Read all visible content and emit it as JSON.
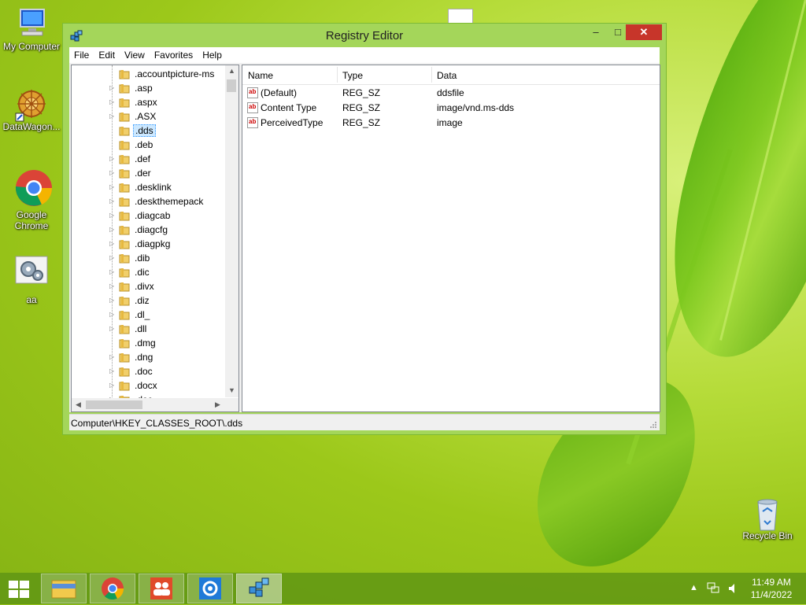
{
  "desktop": {
    "icons": [
      {
        "label": "My Computer",
        "icon": "computer-icon"
      },
      {
        "label": "DataWagon...",
        "icon": "datawagon-icon"
      },
      {
        "label": "Google Chrome",
        "icon": "chrome-icon"
      },
      {
        "label": "aa",
        "icon": "settings-file-icon"
      },
      {
        "label": "Recycle Bin",
        "icon": "recycle-bin-icon"
      }
    ]
  },
  "window": {
    "title": "Registry Editor",
    "menu": [
      "File",
      "Edit",
      "View",
      "Favorites",
      "Help"
    ],
    "controls": {
      "minimize": "–",
      "maximize": "□",
      "close": "✕"
    },
    "tree": {
      "items": [
        {
          "name": ".accountpicture-ms",
          "expandable": false
        },
        {
          "name": ".asp",
          "expandable": true
        },
        {
          "name": ".aspx",
          "expandable": true
        },
        {
          "name": ".ASX",
          "expandable": true
        },
        {
          "name": ".dds",
          "expandable": false,
          "selected": true
        },
        {
          "name": ".deb",
          "expandable": false
        },
        {
          "name": ".def",
          "expandable": true
        },
        {
          "name": ".der",
          "expandable": true
        },
        {
          "name": ".desklink",
          "expandable": true
        },
        {
          "name": ".deskthemepack",
          "expandable": true
        },
        {
          "name": ".diagcab",
          "expandable": true
        },
        {
          "name": ".diagcfg",
          "expandable": true
        },
        {
          "name": ".diagpkg",
          "expandable": true
        },
        {
          "name": ".dib",
          "expandable": true
        },
        {
          "name": ".dic",
          "expandable": true
        },
        {
          "name": ".divx",
          "expandable": true
        },
        {
          "name": ".diz",
          "expandable": true
        },
        {
          "name": ".dl_",
          "expandable": true
        },
        {
          "name": ".dll",
          "expandable": true
        },
        {
          "name": ".dmg",
          "expandable": false
        },
        {
          "name": ".dng",
          "expandable": true
        },
        {
          "name": ".doc",
          "expandable": true
        },
        {
          "name": ".docx",
          "expandable": true
        },
        {
          "name": ".doc",
          "expandable": true
        }
      ]
    },
    "list": {
      "columns": [
        "Name",
        "Type",
        "Data"
      ],
      "rows": [
        {
          "name": "(Default)",
          "type": "REG_SZ",
          "data": "ddsfile"
        },
        {
          "name": "Content Type",
          "type": "REG_SZ",
          "data": "image/vnd.ms-dds"
        },
        {
          "name": "PerceivedType",
          "type": "REG_SZ",
          "data": "image"
        }
      ],
      "value_icon_text": "ab"
    },
    "status_path": "Computer\\HKEY_CLASSES_ROOT\\.dds"
  },
  "taskbar": {
    "apps": [
      "file-explorer-icon",
      "chrome-icon",
      "people-icon",
      "control-panel-icon",
      "registry-editor-icon"
    ],
    "active_app": "registry-editor-icon",
    "clock_time": "11:49 AM",
    "clock_date": "11/4/2022"
  }
}
